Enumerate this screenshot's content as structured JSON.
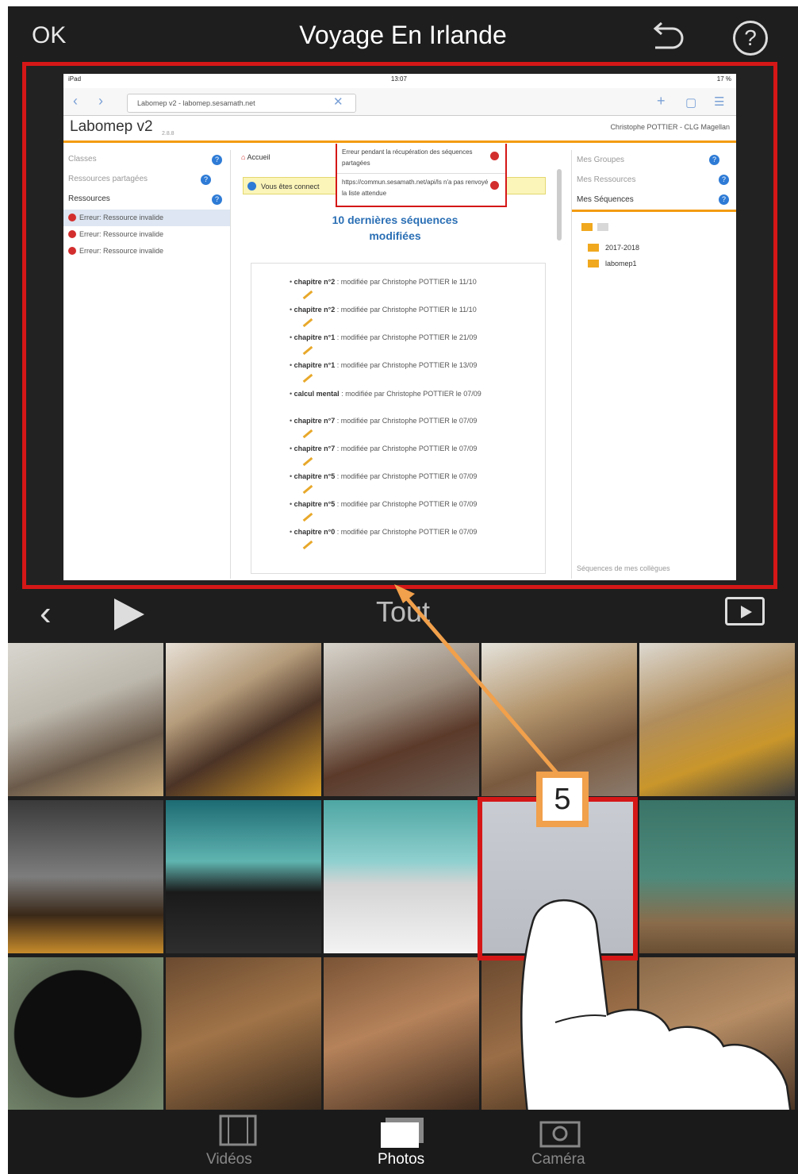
{
  "topbar": {
    "ok_label": "OK",
    "title": "Voyage En Irlande",
    "help_label": "?"
  },
  "browser": {
    "status_left": "iPad",
    "status_time": "13:07",
    "status_right": "17 %",
    "url": "Labomep v2 - labomep.sesamath.net"
  },
  "labomep": {
    "title": "Labomep v2",
    "version": "2.8.8",
    "user": "Christophe POTTIER - CLG Magellan",
    "left": {
      "items": [
        {
          "label": "Classes"
        },
        {
          "label": "Ressources partagées"
        },
        {
          "label": "Ressources"
        }
      ],
      "errors": [
        "Erreur: Ressource invalide",
        "Erreur: Ressource invalide",
        "Erreur: Ressource invalide"
      ]
    },
    "middle": {
      "tab": "Accueil",
      "info": "Vous êtes connect",
      "heading_line1": "10 dernières séquences",
      "heading_line2": "modifiées",
      "sequences": [
        {
          "name": "chapitre n°2",
          "text": " : modifiée par Christophe POTTIER le 11/10"
        },
        {
          "name": "chapitre n°2",
          "text": " : modifiée par Christophe POTTIER le 11/10"
        },
        {
          "name": "chapitre n°1",
          "text": " : modifiée par Christophe POTTIER le 21/09"
        },
        {
          "name": "chapitre n°1",
          "text": " : modifiée par Christophe POTTIER le 13/09"
        },
        {
          "name": "calcul mental",
          "text": " : modifiée par Christophe POTTIER le 07/09"
        },
        {
          "name": "chapitre n°7",
          "text": " : modifiée par Christophe POTTIER le 07/09"
        },
        {
          "name": "chapitre n°7",
          "text": " : modifiée par Christophe POTTIER le 07/09"
        },
        {
          "name": "chapitre n°5",
          "text": " : modifiée par Christophe POTTIER le 07/09"
        },
        {
          "name": "chapitre n°5",
          "text": " : modifiée par Christophe POTTIER le 07/09"
        },
        {
          "name": "chapitre n°0",
          "text": " : modifiée par Christophe POTTIER le 07/09"
        }
      ]
    },
    "error_popup": {
      "line1": "Erreur pendant la récupération des séquences partagées",
      "line2": "https://commun.sesamath.net/api/ls n'a pas renvoyé la liste attendue"
    },
    "right": {
      "items": [
        {
          "label": "Mes Groupes"
        },
        {
          "label": "Mes Ressources"
        },
        {
          "label": "Mes Séquences"
        }
      ],
      "tree": [
        "2017-2018",
        "labomep1"
      ],
      "footer": "Séquences de mes collègues"
    }
  },
  "controls": {
    "album_label": "Tout"
  },
  "callout": {
    "number": "5"
  },
  "tabs": [
    {
      "label": "Vidéos",
      "icon": "film-icon"
    },
    {
      "label": "Photos",
      "icon": "photos-icon"
    },
    {
      "label": "Caméra",
      "icon": "camera-icon"
    }
  ],
  "colors": {
    "highlight": "#d51717",
    "callout": "#f1a04b",
    "background": "#1e1e1e"
  }
}
